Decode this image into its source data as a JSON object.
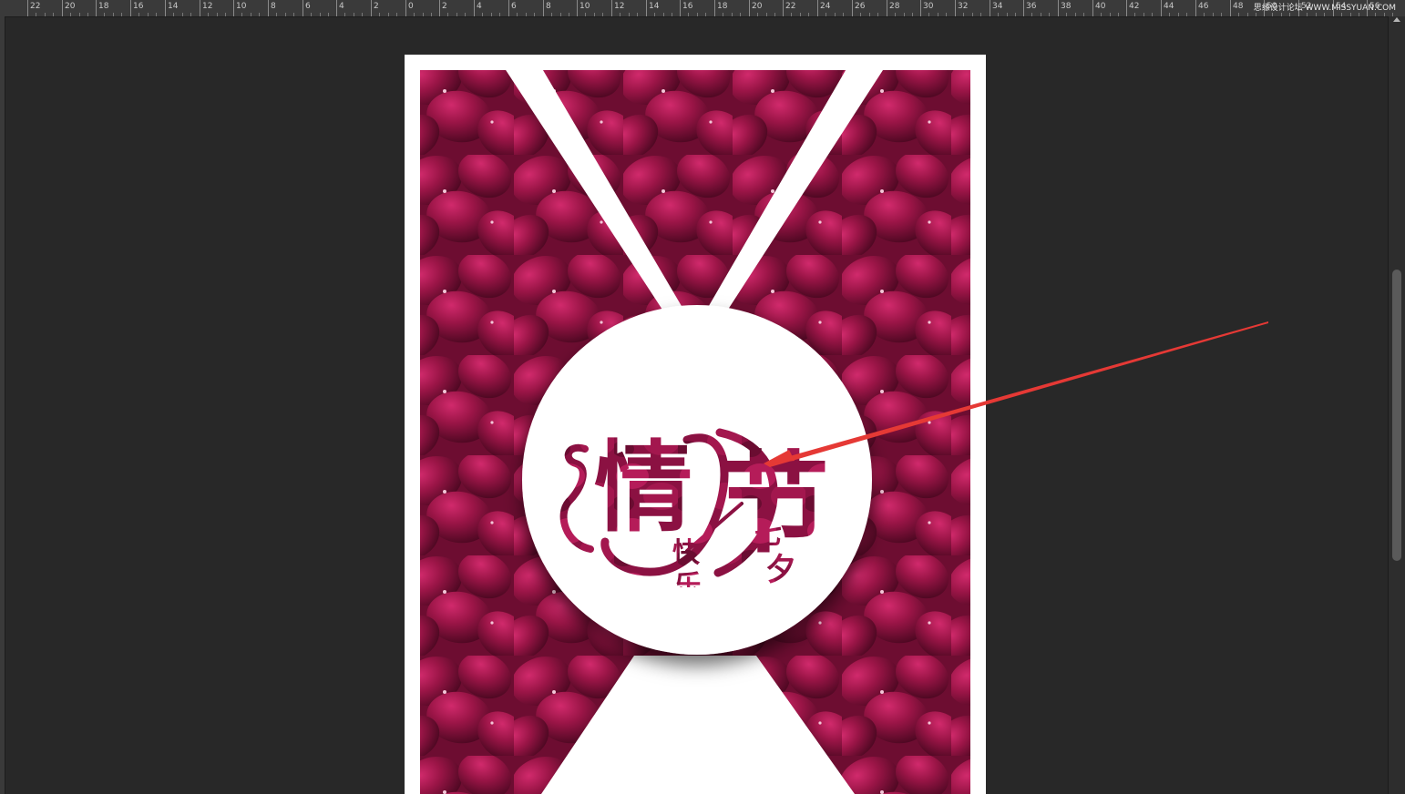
{
  "ruler": {
    "labels": [
      "22",
      "20",
      "18",
      "16",
      "14",
      "12",
      "10",
      "8",
      "6",
      "4",
      "2",
      "0",
      "2",
      "4",
      "6",
      "8",
      "10",
      "12",
      "14",
      "16",
      "18",
      "20",
      "22",
      "24",
      "26",
      "28",
      "30",
      "32",
      "34",
      "36",
      "38",
      "40",
      "42",
      "44",
      "46",
      "48",
      "50",
      "52",
      "54",
      "56"
    ]
  },
  "watermark": "思缘设计论坛 WWW.MISSYUAN.COM",
  "poster": {
    "title_main": "情",
    "title_second": "节",
    "subtitle_kuaile_1": "快",
    "subtitle_kuaile_2": "乐",
    "subtitle_qixi_1": "七",
    "subtitle_qixi_2": "夕"
  },
  "colors": {
    "workspace": "#282828",
    "ruler": "#3a3a3a",
    "petal_base": "#8e1240",
    "petal_light": "#c21f5e",
    "petal_dark": "#5a0a28",
    "accent_arrow": "#e53935"
  }
}
